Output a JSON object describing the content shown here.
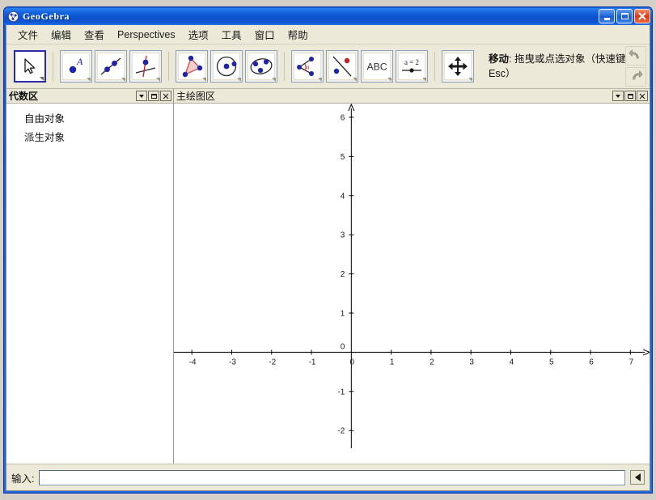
{
  "window": {
    "title": "GeoGebra",
    "icon": "geogebra-logo-icon",
    "buttons": {
      "minimize": "minimize",
      "maximize": "maximize",
      "close": "close"
    }
  },
  "menubar": {
    "items": [
      {
        "label": "文件"
      },
      {
        "label": "编辑"
      },
      {
        "label": "查看"
      },
      {
        "label": "Perspectives"
      },
      {
        "label": "选项"
      },
      {
        "label": "工具"
      },
      {
        "label": "窗口"
      },
      {
        "label": "帮助"
      }
    ]
  },
  "toolbar": {
    "groups": [
      {
        "tools": [
          {
            "name": "move-tool",
            "icon": "pointer-arrow-icon",
            "selected": true,
            "has_caret": true
          }
        ]
      },
      {
        "tools": [
          {
            "name": "point-tool",
            "icon": "point-with-label-icon",
            "selected": false,
            "has_caret": true
          },
          {
            "name": "line-through-two-points-tool",
            "icon": "line-two-points-icon",
            "selected": false,
            "has_caret": true
          },
          {
            "name": "perpendicular-line-tool",
            "icon": "perpendicular-line-icon",
            "selected": false,
            "has_caret": true
          }
        ]
      },
      {
        "tools": [
          {
            "name": "polygon-tool",
            "icon": "triangle-polygon-icon",
            "selected": false,
            "has_caret": true
          },
          {
            "name": "circle-with-center-tool",
            "icon": "circle-center-point-icon",
            "selected": false,
            "has_caret": true
          },
          {
            "name": "conic-through-five-points-tool",
            "icon": "ellipse-points-icon",
            "selected": false,
            "has_caret": true
          }
        ]
      },
      {
        "tools": [
          {
            "name": "angle-tool",
            "icon": "angle-alpha-icon",
            "selected": false,
            "has_caret": true
          },
          {
            "name": "reflect-about-line-tool",
            "icon": "mirror-reflect-icon",
            "selected": false,
            "has_caret": true
          },
          {
            "name": "text-tool",
            "icon": "abc-text-icon",
            "label": "ABC",
            "selected": false,
            "has_caret": true
          },
          {
            "name": "slider-tool",
            "icon": "slider-a-equals-2-icon",
            "label": "a = 2",
            "selected": false,
            "has_caret": true
          }
        ]
      },
      {
        "tools": [
          {
            "name": "move-graphics-view-tool",
            "icon": "four-way-move-icon",
            "selected": false,
            "has_caret": true
          }
        ]
      }
    ],
    "help_title": "移动",
    "help_text": ": 拖曳或点选对象（快速键：Esc）",
    "undo": {
      "name": "undo-button",
      "icon": "undo-arrow-icon"
    },
    "redo": {
      "name": "redo-button",
      "icon": "redo-arrow-icon"
    }
  },
  "algebra_panel": {
    "title": "代数区",
    "buttons": [
      "dropdown",
      "restore",
      "close"
    ],
    "items": [
      {
        "label": "自由对象"
      },
      {
        "label": "派生对象"
      }
    ]
  },
  "graphics_panel": {
    "title": "主绘图区",
    "buttons": [
      "dropdown",
      "restore",
      "close"
    ]
  },
  "chart_data": {
    "type": "scatter",
    "title": "",
    "xlabel": "",
    "ylabel": "",
    "grid": false,
    "axis_color": "#000000",
    "background": "#ffffff",
    "xlim": [
      -4.45,
      7.5
    ],
    "ylim": [
      -2.45,
      6.35
    ],
    "x_ticks": [
      -4,
      -3,
      -2,
      -1,
      0,
      1,
      2,
      3,
      4,
      5,
      6,
      7
    ],
    "y_ticks": [
      -2,
      -1,
      0,
      1,
      2,
      3,
      4,
      5,
      6
    ],
    "origin_label": "0",
    "series": [],
    "axis_arrows": [
      "x-positive",
      "y-positive"
    ]
  },
  "input_bar": {
    "label": "输入:",
    "value": "",
    "placeholder": "",
    "symbol_button": "symbol-dropdown-button"
  }
}
